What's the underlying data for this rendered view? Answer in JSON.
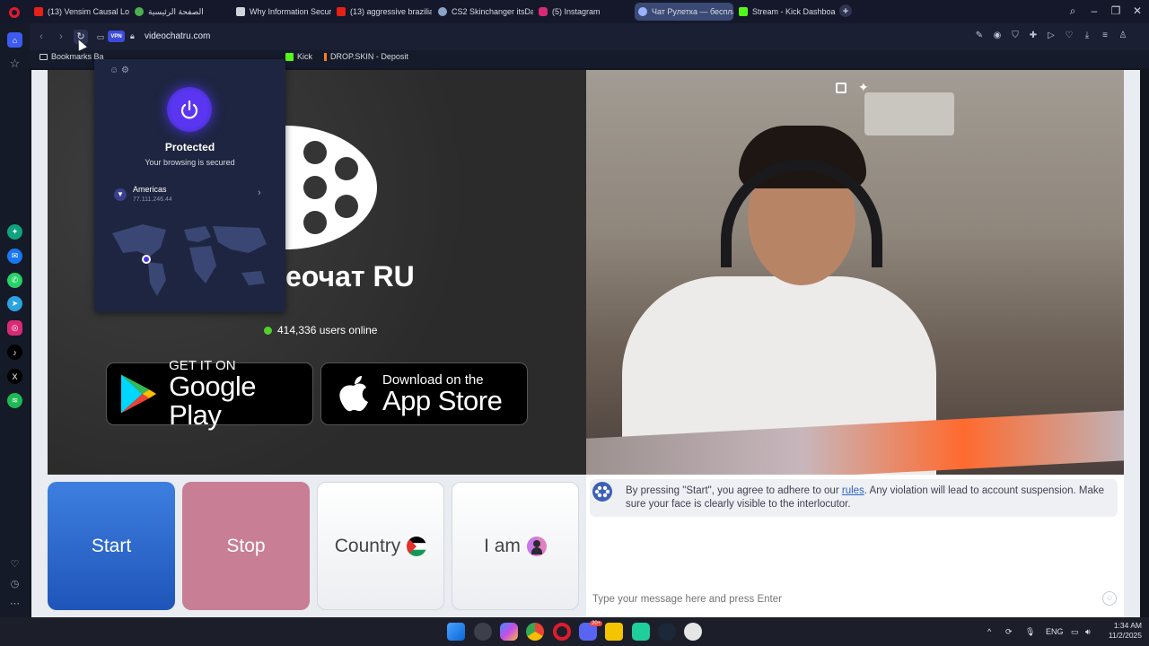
{
  "tabs": [
    {
      "label": "(13) Vensim Causal Loop D",
      "icon": "youtube-icon",
      "color": "#e62117"
    },
    {
      "label": "الصفحة الرئيسية",
      "icon": "site-icon",
      "color": "#4caf50"
    },
    {
      "label": "Why Information Security",
      "icon": "doc-icon",
      "color": "#d0d3da"
    },
    {
      "label": "(13) aggressive brazilian p",
      "icon": "youtube-icon",
      "color": "#e62117"
    },
    {
      "label": "CS2 Skinchanger itsDaBoR",
      "icon": "steam-icon",
      "color": "#8aa3c7"
    },
    {
      "label": "(5) Instagram",
      "icon": "instagram-icon",
      "color": "#d62976"
    },
    {
      "label": "Чат Рулетка — бесплат",
      "icon": "gear-icon",
      "color": "#9bb2ff"
    },
    {
      "label": "Stream - Kick Dashboard",
      "icon": "kick-icon",
      "color": "#53fc18"
    }
  ],
  "address": {
    "vpn_label": "VPN",
    "url": "videochatru.com"
  },
  "bookmarks": [
    {
      "label": "Bookmarks Ba",
      "icon": "folder-icon"
    },
    {
      "label": "Kick",
      "icon": "kick-icon"
    },
    {
      "label": "DROP.SKIN - Deposit",
      "icon": "dropskin-icon"
    }
  ],
  "vpn_popup": {
    "status": "Protected",
    "sub": "Your browsing is secured",
    "region": "Americas",
    "ip": "77.111.246.44"
  },
  "site": {
    "title": "еочат RU",
    "online": "414,336 users online",
    "google_small": "GET IT ON",
    "google_big": "Google Play",
    "apple_small": "Download on the",
    "apple_big": "App Store"
  },
  "controls": {
    "start": "Start",
    "stop": "Stop",
    "country": "Country",
    "iam": "I am"
  },
  "chat": {
    "notice_pre": "By pressing \"Start\", you agree to adhere to our ",
    "notice_link": "rules",
    "notice_post": ". Any violation will lead to account suspension. Make sure your face is clearly visible to the interlocutor.",
    "placeholder": "Type your message here and press Enter"
  },
  "taskbar": {
    "lang": "ENG",
    "time": "1:34 AM",
    "date": "11/2/2025",
    "badge": "20+"
  }
}
